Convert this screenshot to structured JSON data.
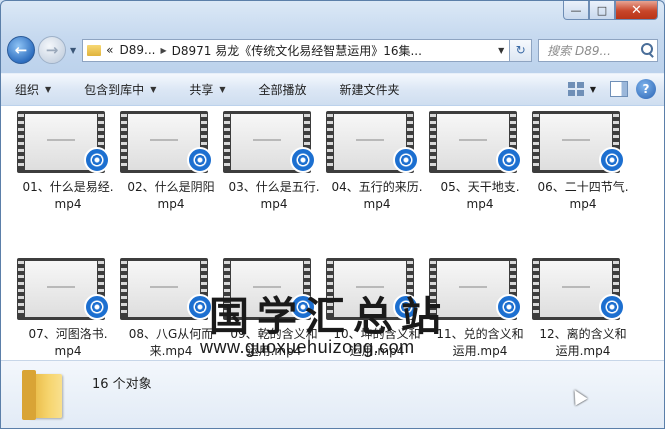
{
  "window": {
    "minimize_glyph": "—",
    "maximize_glyph": "□",
    "close_glyph": "✕"
  },
  "nav": {
    "back_glyph": "←",
    "forward_glyph": "→",
    "breadcrumb_prefix": "«",
    "breadcrumbs": [
      "D89...",
      "D8971 易龙《传统文化易经智慧运用》16集..."
    ],
    "search_placeholder": "搜索 D89...",
    "refresh_glyph": "↻"
  },
  "toolbar": {
    "items": [
      "组织",
      "包含到库中",
      "共享",
      "全部播放",
      "新建文件夹"
    ],
    "help_glyph": "?"
  },
  "files": [
    {
      "line1": "01、什么是易经.",
      "line2": "mp4"
    },
    {
      "line1": "02、什么是阴阳",
      "line2": "mp4"
    },
    {
      "line1": "03、什么是五行.",
      "line2": "mp4"
    },
    {
      "line1": "04、五行的来历.",
      "line2": "mp4"
    },
    {
      "line1": "05、天干地支.",
      "line2": "mp4"
    },
    {
      "line1": "06、二十四节气.",
      "line2": "mp4"
    },
    {
      "line1": "07、河图洛书.",
      "line2": "mp4"
    },
    {
      "line1": "08、八G从何而",
      "line2": "来.mp4"
    },
    {
      "line1": "09、乾的含义和",
      "line2": "运用.mp4"
    },
    {
      "line1": "10、坤的含义和",
      "line2": "运用.mp4"
    },
    {
      "line1": "11、兑的含义和",
      "line2": "运用.mp4"
    },
    {
      "line1": "12、离的含义和",
      "line2": "运用.mp4"
    }
  ],
  "watermark": {
    "title": "国学汇总站",
    "url": "www.guoxuehuizong.com"
  },
  "details": {
    "count": "16 个对象"
  }
}
